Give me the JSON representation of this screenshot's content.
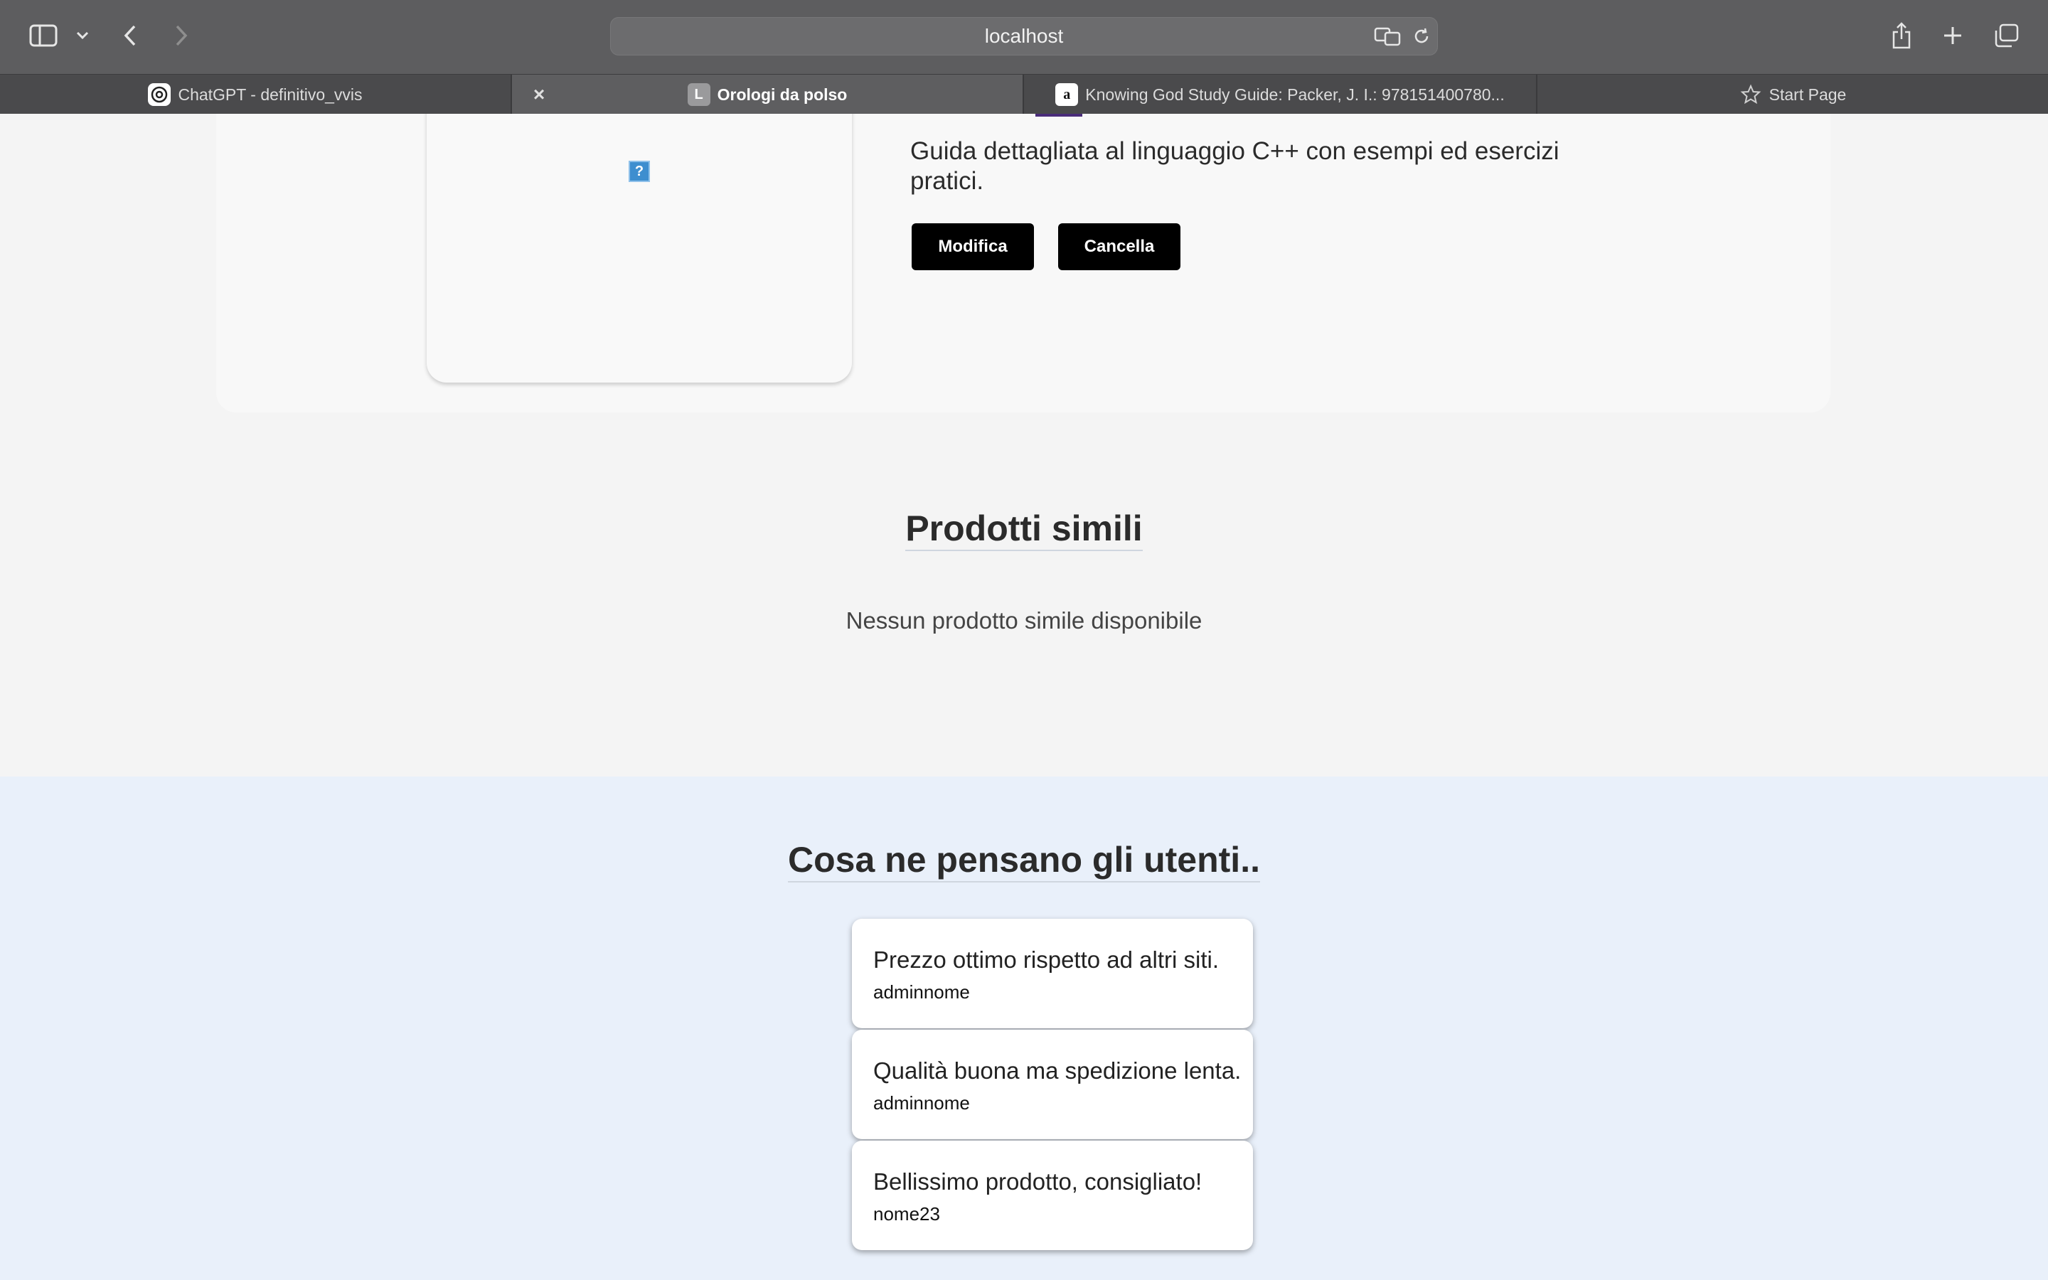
{
  "browser": {
    "address": "localhost",
    "tabs": [
      {
        "label": "ChatGPT - definitivo_vvis",
        "favicon": "openai-icon"
      },
      {
        "label": "Orologi da polso",
        "favicon": "L",
        "active": true
      },
      {
        "label": "Knowing God Study Guide: Packer, J. I.: 978151400780...",
        "favicon": "amazon-icon"
      },
      {
        "label": "Start Page",
        "favicon": "star-icon"
      }
    ]
  },
  "product": {
    "description": "Guida dettagliata al linguaggio C++ con esempi ed esercizi pratici.",
    "edit_label": "Modifica",
    "delete_label": "Cancella"
  },
  "similar": {
    "title": "Prodotti simili",
    "empty_message": "Nessun prodotto simile disponibile"
  },
  "reviews": {
    "title": "Cosa ne pensano gli utenti..",
    "items": [
      {
        "text": "Prezzo ottimo rispetto ad altri siti.",
        "user": "adminnome"
      },
      {
        "text": "Qualità buona ma spedizione lenta.",
        "user": "adminnome"
      },
      {
        "text": "Bellissimo prodotto, consigliato!",
        "user": "nome23"
      }
    ]
  }
}
